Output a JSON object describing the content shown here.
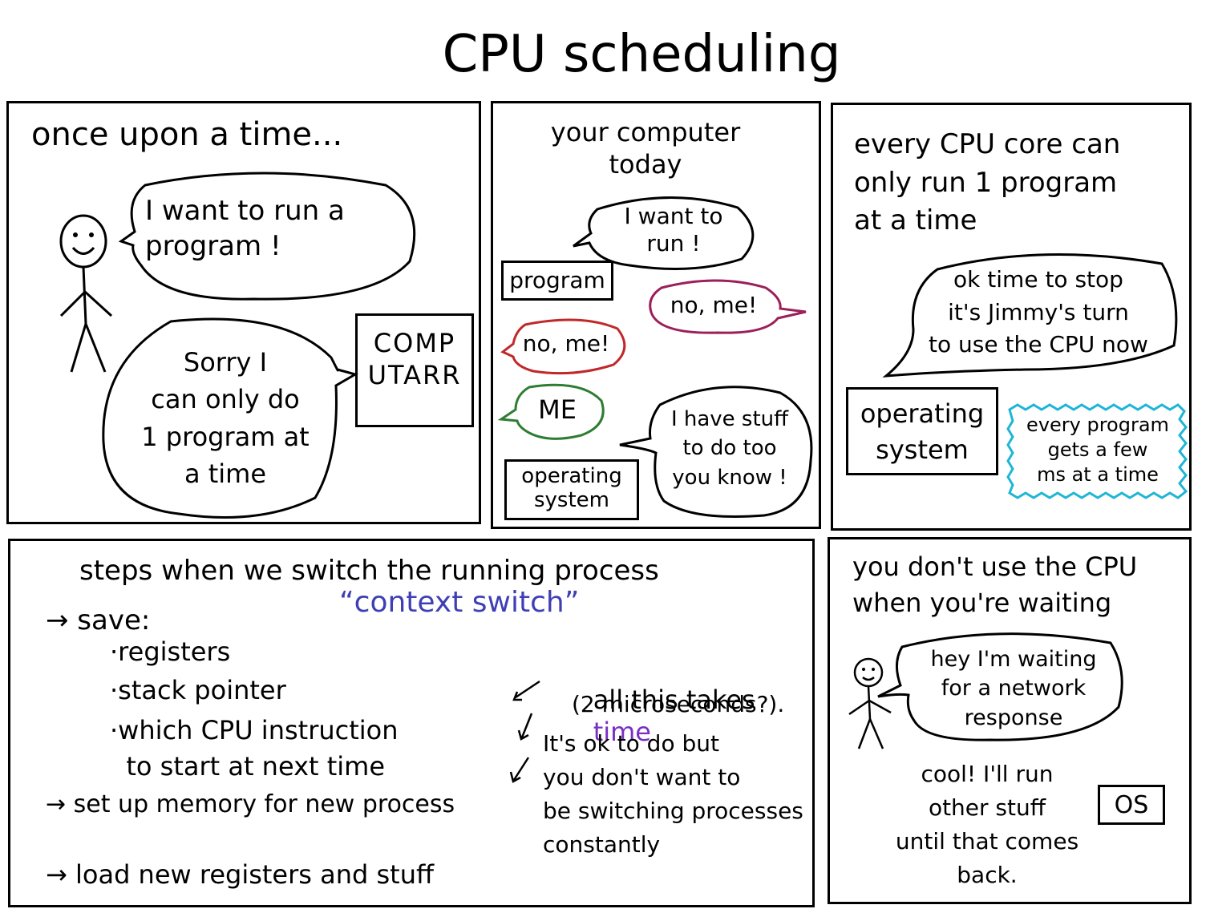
{
  "title": "CPU scheduling",
  "colors": {
    "ink": "#000000",
    "highlight_blue": "#3f3fb5",
    "highlight_purple": "#7a2fc4",
    "bubble_red": "#c0282a",
    "bubble_purple": "#9b1f5a",
    "bubble_green": "#2e7d32",
    "bubble_cyan": "#1fb5d6"
  },
  "panel1": {
    "heading": "once upon a time...",
    "person_bubble": "I want to run a\nprogram !",
    "computer_bubble": "Sorry I\ncan only do\n1 program at\na time",
    "computer_label": "COMP\nUTARR"
  },
  "panel2": {
    "heading": "your computer\ntoday",
    "program_bubble": "I want to\nrun !",
    "program_label": "program",
    "bubble_no_me_purple": "no, me!",
    "bubble_no_me_red": "no, me!",
    "bubble_me_green": "ME",
    "os_bubble": "I have stuff\nto do too\nyou know !",
    "os_label": "operating\nsystem"
  },
  "panel3": {
    "heading": "every CPU core can\nonly run 1 program\nat a time",
    "os_bubble": "ok time to stop\nit's Jimmy's turn\nto use the CPU now",
    "os_label": "operating\nsystem",
    "note": "every program\ngets a few\nms at a time"
  },
  "panel4": {
    "heading": "steps when we switch the running process",
    "context_switch": "“context switch”",
    "save": "→ save:",
    "save_items": [
      "·registers",
      "·stack pointer",
      "·which CPU instruction\n  to start at next time"
    ],
    "setup_memory": "→ set up memory for new process",
    "load_registers": "→ load new registers and stuff",
    "all_this": "all this takes",
    "time_word": "time",
    "microseconds": "(2 microseconds?).",
    "its_ok": "It's ok to do but\nyou don't want to\nbe switching processes\nconstantly"
  },
  "panel5": {
    "heading": "you don't use the CPU\nwhen you're waiting",
    "person_bubble": "hey I'm waiting\nfor a network\nresponse",
    "os_reply": "cool! I'll run\nother stuff\nuntil that comes\nback.",
    "os_label": "OS"
  }
}
